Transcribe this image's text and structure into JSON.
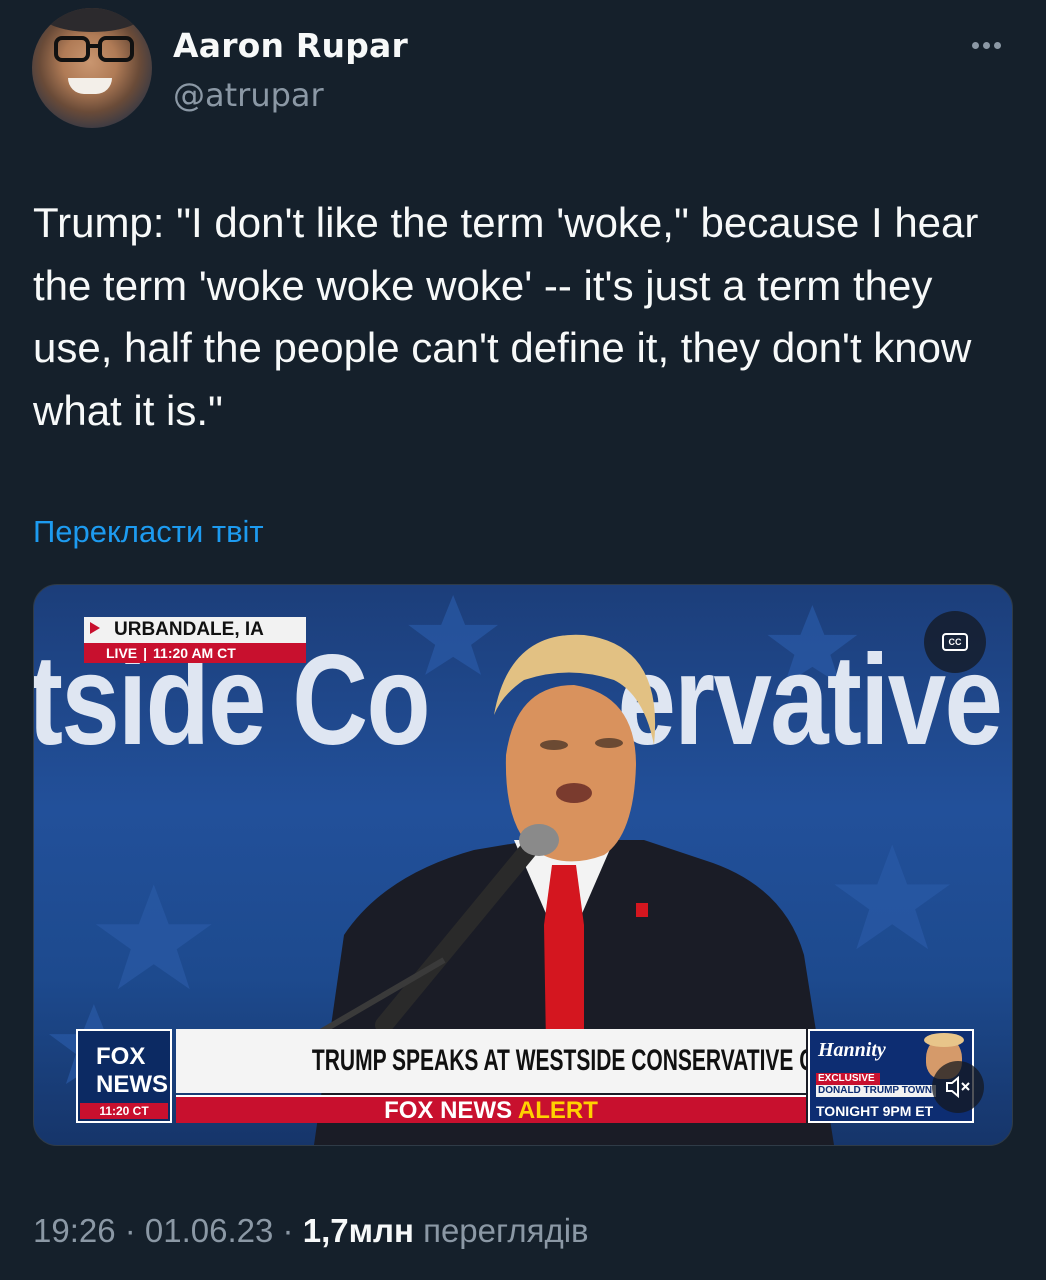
{
  "author": {
    "name": "Aaron Rupar",
    "handle": "@atrupar",
    "avatar_icon": "profile-photo"
  },
  "more_icon": "more-horizontal-icon",
  "tweet": {
    "text": "Trump: \"I don't like the term 'woke,\" because I hear the term 'woke woke woke' -- it's just a term they use, half the people can't define it, they don't know what it is.\"",
    "translate_label": "Перекласти твіт"
  },
  "video": {
    "background_text_left": "tside Co",
    "background_text_right": "ervative",
    "location": "URBANDALE, IA",
    "live_label": "LIVE",
    "live_separator": "|",
    "live_time": "11:20 AM CT",
    "cc_label": "CC",
    "network_logo_line1": "FOX",
    "network_logo_line2": "NEWS",
    "network_time": "11:20 CT",
    "headline": "TRUMP SPEAKS AT WESTSIDE CONSERVATIVE CLUB IN IOWA",
    "alert_prefix": "FOX NEWS",
    "alert_word": "ALERT",
    "promo_show": "Hannity",
    "promo_exclusive": "EXCLUSIVE",
    "promo_event": "DONALD TRUMP TOWN",
    "promo_time": "TONIGHT 9PM ET",
    "mute_icon": "volume-muted-icon"
  },
  "meta": {
    "time": "19:26",
    "separator1": " · ",
    "date": "01.06.23",
    "separator2": " · ",
    "views_count": "1,7млн",
    "views_label": " переглядів"
  },
  "colors": {
    "background": "#15202b",
    "text": "#f7f9f9",
    "secondary": "#8b98a5",
    "link": "#1d9bf0",
    "fox_red": "#c8102e",
    "fox_blue": "#0c2a63"
  }
}
